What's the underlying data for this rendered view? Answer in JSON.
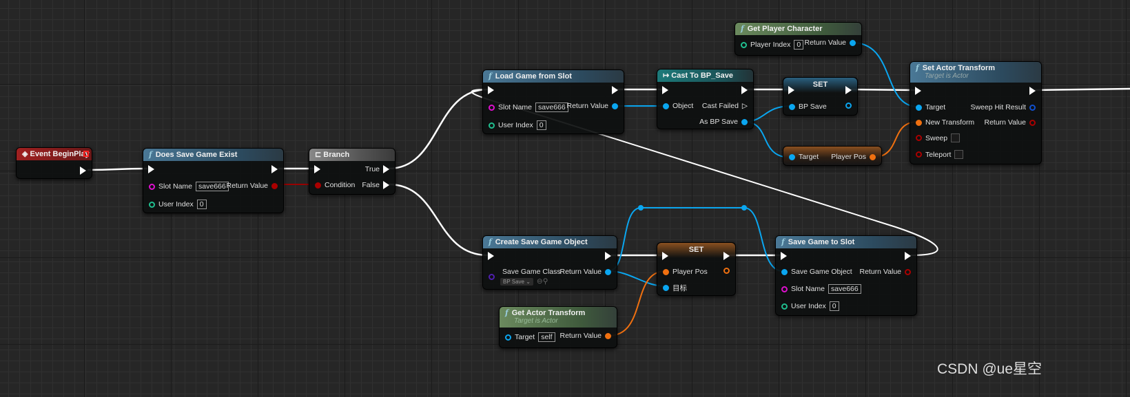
{
  "nodes": {
    "event_begin_play": {
      "title": "Event BeginPlay"
    },
    "does_save_game_exist": {
      "title": "Does Save Game Exist",
      "slot_name_label": "Slot Name",
      "slot_name_value": "save666",
      "user_index_label": "User Index",
      "user_index_value": "0",
      "return_label": "Return Value"
    },
    "branch": {
      "title": "Branch",
      "condition_label": "Condition",
      "true_label": "True",
      "false_label": "False"
    },
    "load_game_from_slot": {
      "title": "Load Game from Slot",
      "slot_name_label": "Slot Name",
      "slot_name_value": "save666",
      "user_index_label": "User Index",
      "user_index_value": "0",
      "return_label": "Return Value"
    },
    "cast_to_bp_save": {
      "title": "Cast To BP_Save",
      "object_label": "Object",
      "cast_failed_label": "Cast Failed",
      "as_label": "As BP Save"
    },
    "set_bp_save": {
      "title": "SET",
      "pin_label": "BP Save"
    },
    "get_player_pos": {
      "target_label": "Target",
      "output_label": "Player Pos"
    },
    "get_player_character": {
      "title": "Get Player Character",
      "player_index_label": "Player Index",
      "player_index_value": "0",
      "return_label": "Return Value"
    },
    "set_actor_transform": {
      "title": "Set Actor Transform",
      "subtitle": "Target is Actor",
      "target_label": "Target",
      "new_transform_label": "New Transform",
      "sweep_label": "Sweep",
      "teleport_label": "Teleport",
      "sweep_hit_label": "Sweep Hit Result",
      "return_label": "Return Value"
    },
    "create_save_game_object": {
      "title": "Create Save Game Object",
      "class_label": "Save Game Class",
      "class_value": "BP Save",
      "return_label": "Return Value"
    },
    "set_player_pos": {
      "title": "SET",
      "pin_label": "Player Pos",
      "target_label": "目标"
    },
    "get_actor_transform": {
      "title": "Get Actor Transform",
      "subtitle": "Target is Actor",
      "target_label": "Target",
      "target_value": "self",
      "return_label": "Return Value"
    },
    "save_game_to_slot": {
      "title": "Save Game to Slot",
      "object_label": "Save Game Object",
      "slot_name_label": "Slot Name",
      "slot_name_value": "save666",
      "user_index_label": "User Index",
      "user_index_value": "0",
      "return_label": "Return Value"
    }
  },
  "colors": {
    "exec": "#ffffff",
    "object": "#0aa6f0",
    "string": "#e010d0",
    "int": "#20c090",
    "bool": "#a00000",
    "transform": "#f07010",
    "class": "#5020b0"
  },
  "watermark": "CSDN @ue星空"
}
